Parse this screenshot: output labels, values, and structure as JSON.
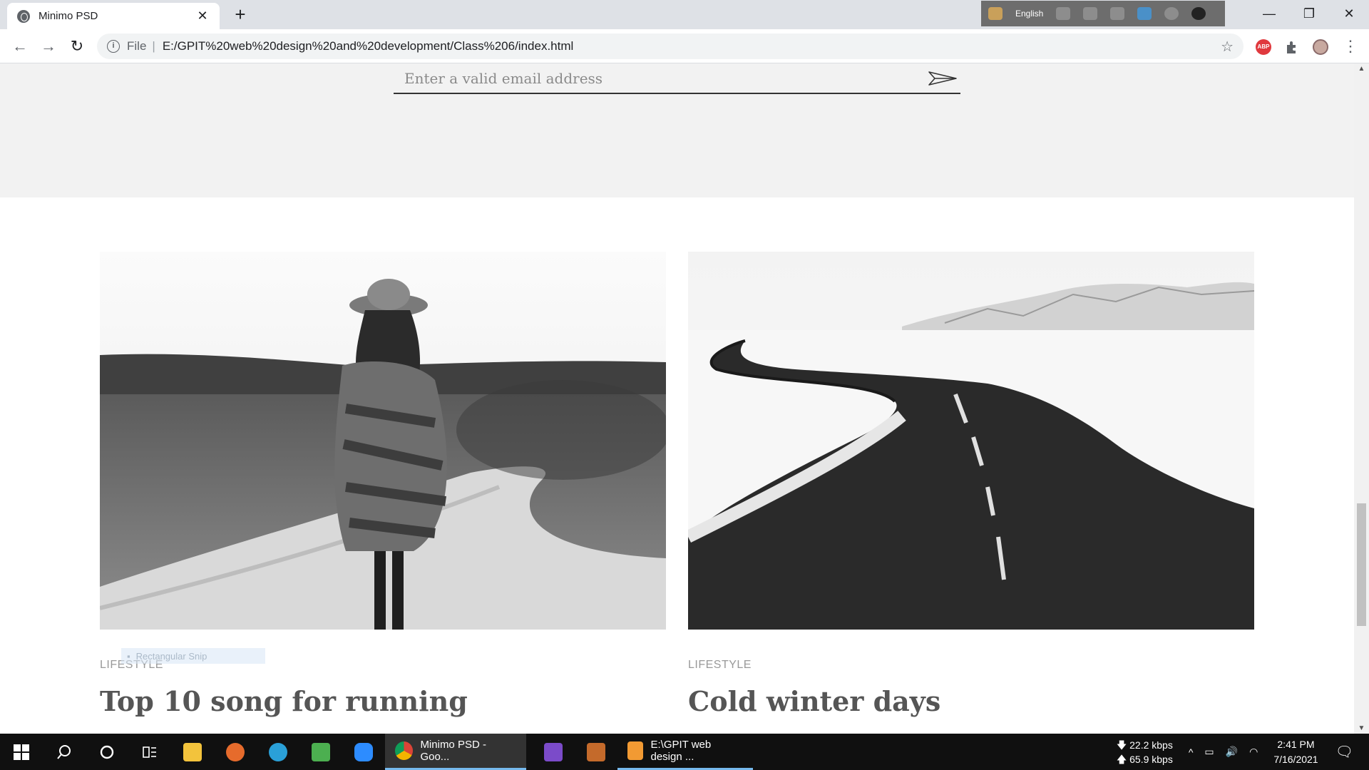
{
  "browser": {
    "tab_title": "Minimo PSD",
    "tab_close": "✕",
    "new_tab": "+",
    "extension_language": "English",
    "window_controls": {
      "minimize": "—",
      "restore": "❐",
      "close": "✕"
    },
    "address": {
      "scheme_label": "File",
      "separator": "|",
      "url": "E:/GPIT%20web%20design%20and%20development/Class%206/index.html"
    },
    "nav": {
      "back": "←",
      "forward": "→",
      "reload": "↻"
    },
    "menu": "⋮",
    "abp_label": "ABP"
  },
  "page": {
    "newsletter": {
      "placeholder": "Enter a valid email address"
    },
    "posts": [
      {
        "category": "LIFESTYLE",
        "title": "Top 10 song for running"
      },
      {
        "category": "LIFESTYLE",
        "title": "Cold winter days"
      }
    ],
    "snip_overlay_text": "Rectangular Snip"
  },
  "scrollbar": {
    "position_fraction": 0.82
  },
  "taskbar": {
    "tasks": [
      {
        "label": "Minimo PSD - Goo...",
        "state": "active",
        "icon": "chrome-icon"
      },
      {
        "label": "E:\\GPIT web design ...",
        "state": "open",
        "icon": "sublime-text-icon"
      }
    ],
    "network": {
      "down": "22.2 kbps",
      "up": "65.9 kbps"
    },
    "clock": {
      "time": "2:41 PM",
      "date": "7/16/2021"
    }
  },
  "colors": {
    "newsletter_bg": "#f2f2f2",
    "category": "#999999",
    "post_title": "#555555",
    "taskbar": "#101010",
    "task_underline": "#76b9ed"
  }
}
